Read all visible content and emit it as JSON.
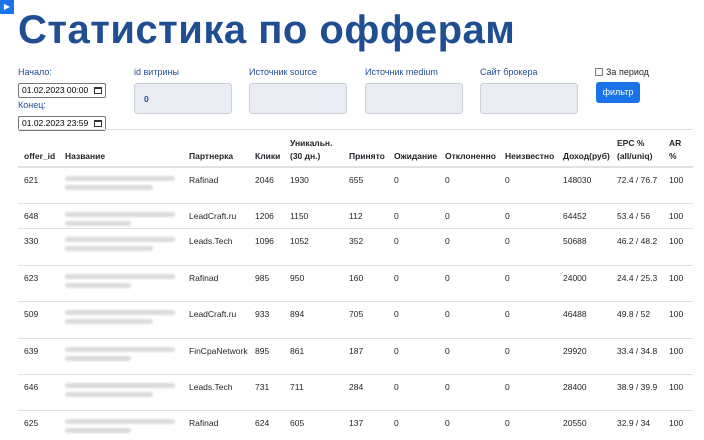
{
  "title": "Статистика по офферам",
  "filters": {
    "start_label": "Начало:",
    "start_value": "01.02.2023 00:00",
    "end_label": "Конец:",
    "end_value": "01.02.2023 23:59",
    "showcase_label": "id витрины",
    "showcase_value": "0",
    "source_label": "Источник source",
    "source_value": "",
    "medium_label": "Источник medium",
    "medium_value": "",
    "broker_label": "Сайт брокера",
    "broker_value": "",
    "period_label": "За период",
    "period_checked": false,
    "filter_button": "фильтр"
  },
  "table": {
    "headers": {
      "offer_id": "offer_id",
      "name": "Название",
      "partner": "Партнерка",
      "clicks": "Клики",
      "unique_1": "Уникальн.",
      "unique_2": "(30 дн.)",
      "accepted": "Принято",
      "waiting": "Ожидание",
      "rejected": "Отклоненно",
      "unknown": "Неизвестно",
      "income": "Доход(руб)",
      "epc_1": "EPC %",
      "epc_2": "(all/uniq)",
      "ar_1": "AR",
      "ar_2": "%"
    },
    "rows": [
      {
        "offer_id": "621",
        "partner": "Rafinad",
        "clicks": "2046",
        "unique": "1930",
        "accepted": "655",
        "waiting": "0",
        "rejected": "0",
        "unknown": "0",
        "income": "148030",
        "epc": "72.4 / 76.7",
        "ar": "100"
      },
      {
        "offer_id": "648",
        "partner": "LeadCraft.ru",
        "clicks": "1206",
        "unique": "1150",
        "accepted": "112",
        "waiting": "0",
        "rejected": "0",
        "unknown": "0",
        "income": "64452",
        "epc": "53.4 / 56",
        "ar": "100"
      },
      {
        "offer_id": "330",
        "partner": "Leads.Tech",
        "clicks": "1096",
        "unique": "1052",
        "accepted": "352",
        "waiting": "0",
        "rejected": "0",
        "unknown": "0",
        "income": "50688",
        "epc": "46.2 / 48.2",
        "ar": "100"
      },
      {
        "offer_id": "623",
        "partner": "Rafinad",
        "clicks": "985",
        "unique": "950",
        "accepted": "160",
        "waiting": "0",
        "rejected": "0",
        "unknown": "0",
        "income": "24000",
        "epc": "24.4 / 25.3",
        "ar": "100"
      },
      {
        "offer_id": "509",
        "partner": "LeadCraft.ru",
        "clicks": "933",
        "unique": "894",
        "accepted": "705",
        "waiting": "0",
        "rejected": "0",
        "unknown": "0",
        "income": "46488",
        "epc": "49.8 / 52",
        "ar": "100"
      },
      {
        "offer_id": "639",
        "partner": "FinCpaNetwork",
        "clicks": "895",
        "unique": "861",
        "accepted": "187",
        "waiting": "0",
        "rejected": "0",
        "unknown": "0",
        "income": "29920",
        "epc": "33.4 / 34.8",
        "ar": "100"
      },
      {
        "offer_id": "646",
        "partner": "Leads.Tech",
        "clicks": "731",
        "unique": "711",
        "accepted": "284",
        "waiting": "0",
        "rejected": "0",
        "unknown": "0",
        "income": "28400",
        "epc": "38.9 / 39.9",
        "ar": "100"
      },
      {
        "offer_id": "625",
        "partner": "Rafinad",
        "clicks": "624",
        "unique": "605",
        "accepted": "137",
        "waiting": "0",
        "rejected": "0",
        "unknown": "0",
        "income": "20550",
        "epc": "32.9 / 34",
        "ar": "100"
      }
    ]
  }
}
